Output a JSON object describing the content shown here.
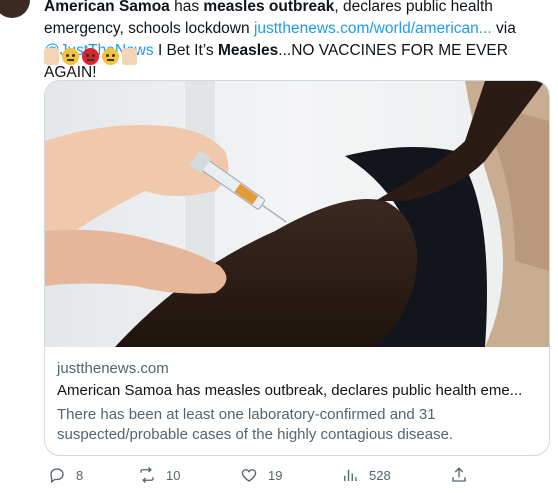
{
  "tweet": {
    "part1_bold": "American Samoa",
    "part2": " has ",
    "part3_bold": "measles outbreak",
    "part4": ", declares public health emergency, schools lockdown ",
    "link": "justthenews.com/world/american...",
    "part5": " via ",
    "mention": "@JustTheNews",
    "part6": " I Bet It’s ",
    "part7_bold": "Measles",
    "part8": "...NO VACCINES FOR ME EVER AGAIN!"
  },
  "emojis": [
    "thumbs-down",
    "face-with-raised-eyebrow",
    "angry-face",
    "face-with-raised-eyebrow",
    "thumbs-down"
  ],
  "card": {
    "domain": "justthenews.com",
    "title": "American Samoa has measles outbreak, declares public health eme...",
    "description": "There has been at least one laboratory-confirmed and 31 suspected/probable cases of the highly contagious disease."
  },
  "actions": {
    "replies": "8",
    "reposts": "10",
    "likes": "19",
    "views": "528"
  },
  "colors": {
    "link": "#1d9bf0",
    "secondary_text": "#536471",
    "border": "#cfd9de"
  }
}
